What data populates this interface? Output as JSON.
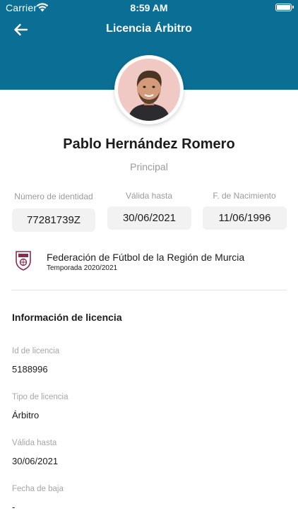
{
  "status_bar": {
    "carrier": "Carrier",
    "time": "8:59 AM"
  },
  "colors": {
    "header_bg": "#0a6e95"
  },
  "nav": {
    "title": "Licencia Árbitro",
    "back_icon": "arrow-left-icon"
  },
  "profile": {
    "name": "Pablo Hernández Romero",
    "role": "Principal"
  },
  "id_fields": [
    {
      "label": "Número de identidad",
      "value": "77281739Z"
    },
    {
      "label": "Válida hasta",
      "value": "30/06/2021"
    },
    {
      "label": "F. de Nacimiento",
      "value": "11/06/1996"
    }
  ],
  "federation": {
    "name": "Federación de Fútbol de la Región de Murcia",
    "season": "Temporada 2020/2021",
    "logo_icon": "federation-crest-icon"
  },
  "license_info": {
    "title": "Información de licencia",
    "items": [
      {
        "label": "Id de licencia",
        "value": "5188996"
      },
      {
        "label": "Tipo de licencia",
        "value": "Árbitro"
      },
      {
        "label": "Válida hasta",
        "value": "30/06/2021"
      },
      {
        "label": "Fecha de baja",
        "value": "-"
      }
    ]
  }
}
